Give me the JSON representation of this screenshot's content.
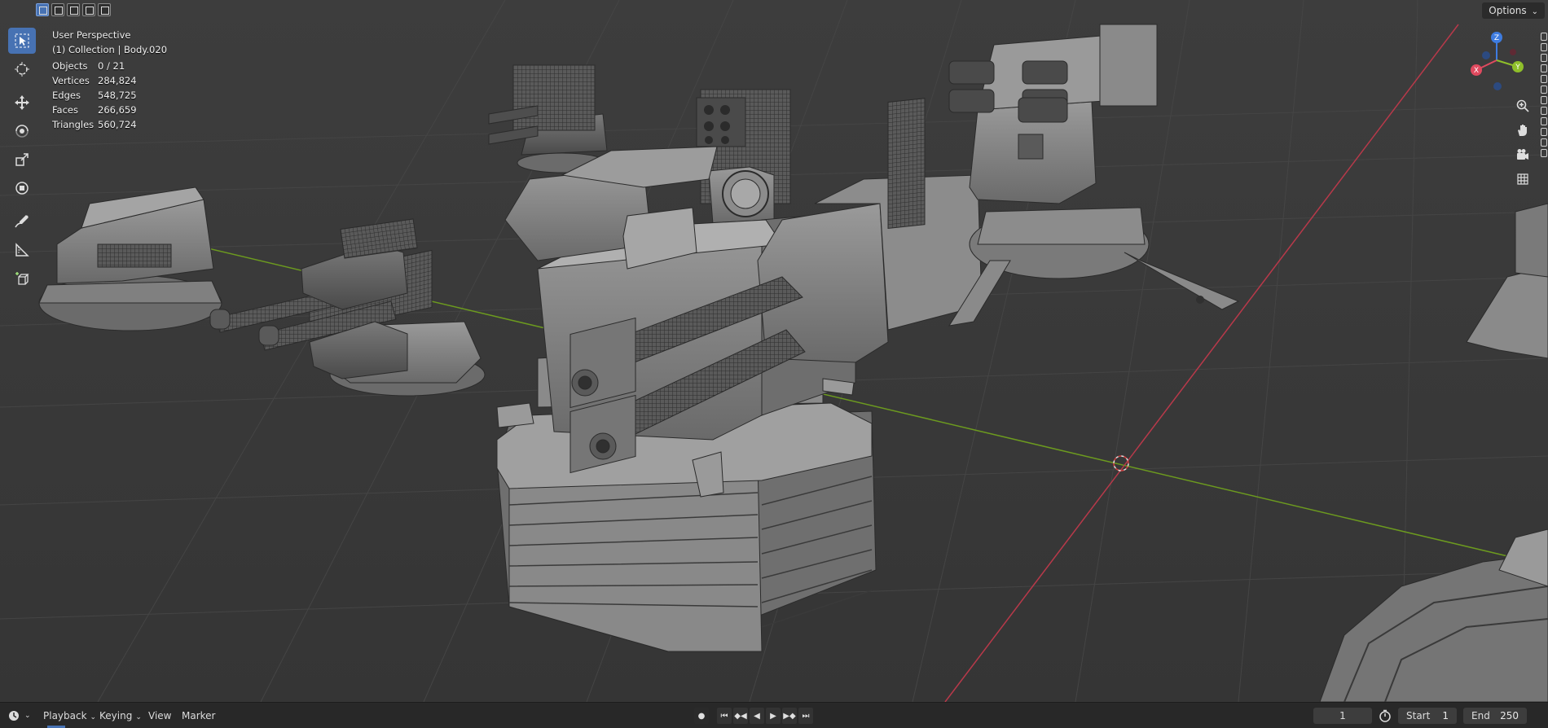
{
  "header": {
    "selection_modes": [
      "select-box-icon",
      "select-new-icon",
      "select-extend-icon",
      "select-subtract-icon",
      "select-intersect-icon"
    ],
    "options_label": "Options"
  },
  "overlay": {
    "view_name": "User Perspective",
    "collection": "(1) Collection | Body.020",
    "stats": [
      {
        "label": "Objects",
        "value": "0 / 21"
      },
      {
        "label": "Vertices",
        "value": "284,824"
      },
      {
        "label": "Edges",
        "value": "548,725"
      },
      {
        "label": "Faces",
        "value": "266,659"
      },
      {
        "label": "Triangles",
        "value": "560,724"
      }
    ]
  },
  "toolbar": {
    "tools": [
      "select-box-icon",
      "cursor-icon",
      "move-icon",
      "rotate-icon",
      "scale-icon",
      "transform-icon",
      "annotate-icon",
      "measure-icon",
      "add-cube-icon"
    ],
    "active_tool": "select-box-icon"
  },
  "gizmo": {
    "axes": [
      "X",
      "Y",
      "Z"
    ],
    "colors": {
      "x": "#e04a5f",
      "y": "#8fbf2a",
      "z": "#3e7ce0"
    }
  },
  "timeline": {
    "menus": [
      "Playback",
      "Keying",
      "View",
      "Marker"
    ],
    "current_frame": "1",
    "start_label": "Start",
    "start_value": "1",
    "end_label": "End",
    "end_value": "250"
  },
  "colors": {
    "viewport_bg": "#3a3a3a",
    "grid_line": "#424242",
    "x_axis": "#b8394a",
    "y_axis": "#6c9a1f",
    "accent": "#4772b3"
  }
}
